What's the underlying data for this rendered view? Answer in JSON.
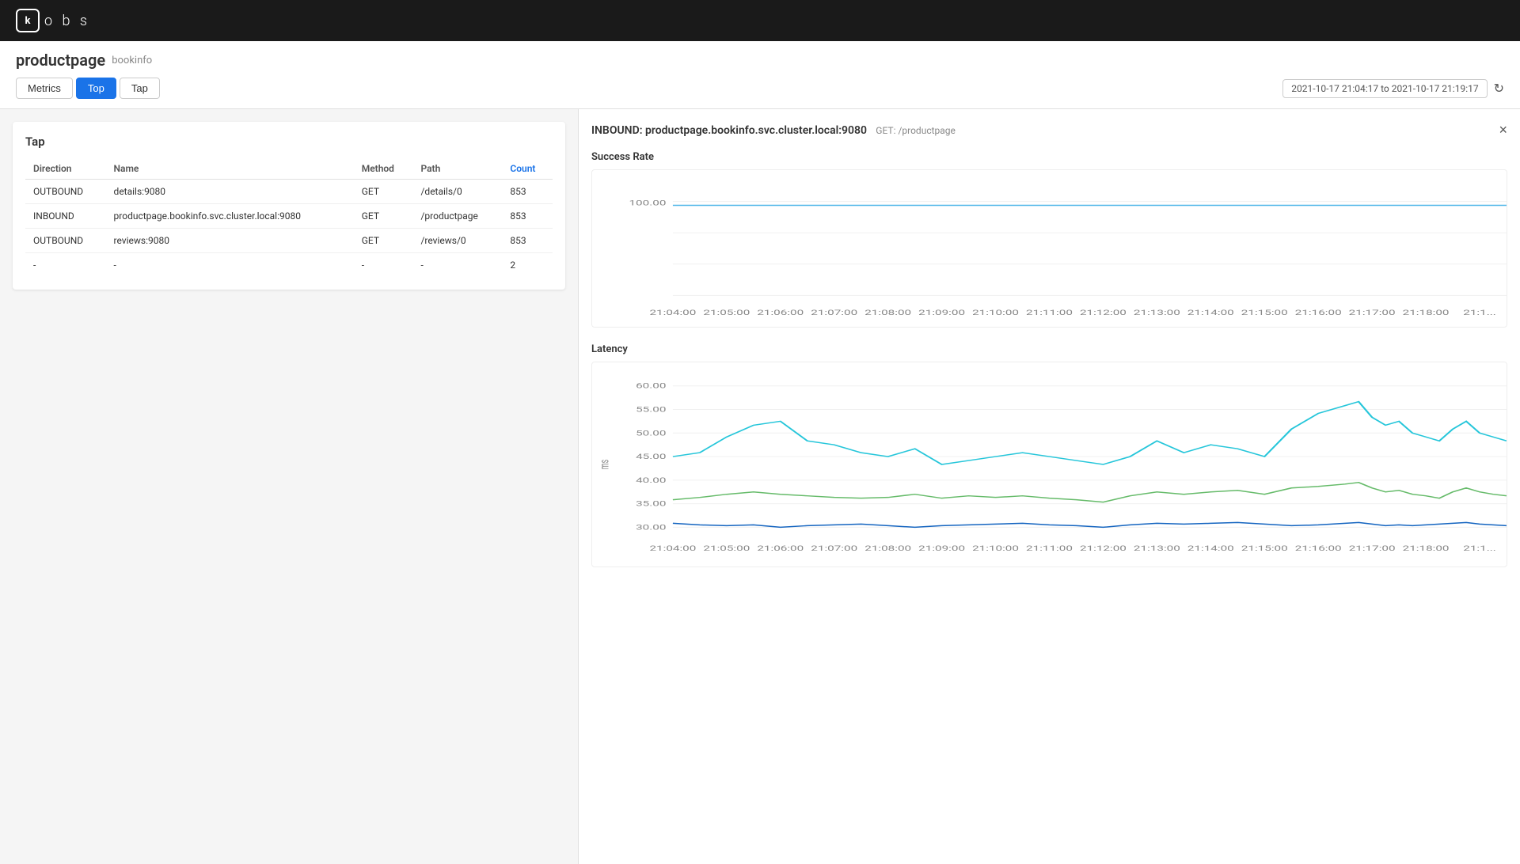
{
  "app": {
    "logo_icon": "k",
    "logo_text": "o b s"
  },
  "header": {
    "title": "productpage",
    "subtitle": "bookinfo",
    "tabs": [
      {
        "id": "metrics",
        "label": "Metrics",
        "active": false
      },
      {
        "id": "top",
        "label": "Top",
        "active": true
      },
      {
        "id": "tap",
        "label": "Tap",
        "active": false
      }
    ],
    "datetime_range": "2021-10-17 21:04:17 to 2021-10-17 21:19:17",
    "refresh_icon": "↻"
  },
  "tap_panel": {
    "title": "Tap",
    "table": {
      "columns": [
        "Direction",
        "Name",
        "Method",
        "Path",
        "Count"
      ],
      "rows": [
        {
          "direction": "OUTBOUND",
          "name": "details:9080",
          "method": "GET",
          "path": "/details/0",
          "count": "853"
        },
        {
          "direction": "INBOUND",
          "name": "productpage.bookinfo.svc.cluster.local:9080",
          "method": "GET",
          "path": "/productpage",
          "count": "853"
        },
        {
          "direction": "OUTBOUND",
          "name": "reviews:9080",
          "method": "GET",
          "path": "/reviews/0",
          "count": "853"
        },
        {
          "direction": "-",
          "name": "-",
          "method": "-",
          "path": "-",
          "count": "2"
        }
      ]
    }
  },
  "detail_panel": {
    "title": "INBOUND: productpage.bookinfo.svc.cluster.local:9080",
    "subtitle": "GET: /productpage",
    "close_icon": "×",
    "success_rate": {
      "title": "Success Rate",
      "y_labels": [
        "100.00"
      ],
      "x_labels": [
        "21:04:00",
        "21:05:00",
        "21:06:00",
        "21:07:00",
        "21:08:00",
        "21:09:00",
        "21:10:00",
        "21:11:00",
        "21:12:00",
        "21:13:00",
        "21:14:00",
        "21:15:00",
        "21:16:00",
        "21:17:00",
        "21:18:00",
        "21:1..."
      ]
    },
    "latency": {
      "title": "Latency",
      "y_labels": [
        "60.00",
        "55.00",
        "50.00",
        "45.00",
        "40.00",
        "35.00",
        "30.00"
      ],
      "y_axis_label": "ms",
      "x_labels": [
        "21:04:00",
        "21:05:00",
        "21:06:00",
        "21:07:00",
        "21:08:00",
        "21:09:00",
        "21:10:00",
        "21:11:00",
        "21:12:00",
        "21:13:00",
        "21:14:00",
        "21:15:00",
        "21:16:00",
        "21:17:00",
        "21:18:00",
        "21:1..."
      ]
    }
  },
  "colors": {
    "active_tab_bg": "#1a73e8",
    "success_line": "#4db6e8",
    "latency_cyan": "#26c6da",
    "latency_green": "#66bb6a",
    "latency_blue": "#1565c0"
  }
}
